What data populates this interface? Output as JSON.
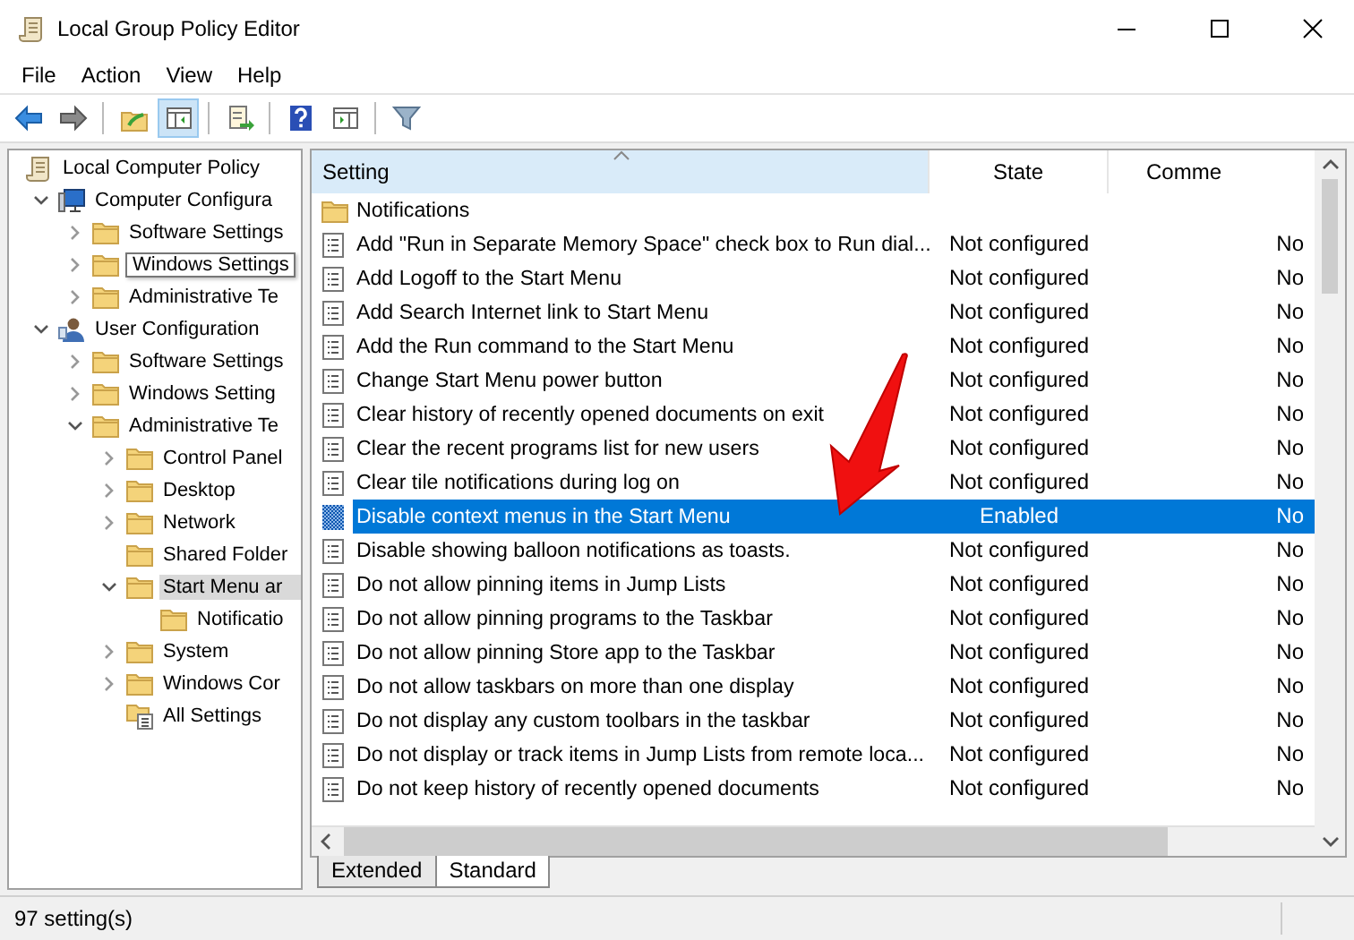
{
  "window": {
    "title": "Local Group Policy Editor"
  },
  "menu": [
    "File",
    "Action",
    "View",
    "Help"
  ],
  "toolbar": [
    {
      "kind": "back",
      "pressed": false
    },
    {
      "kind": "forward",
      "pressed": false
    },
    {
      "kind": "separator"
    },
    {
      "kind": "up",
      "pressed": false
    },
    {
      "kind": "tree-toggle",
      "pressed": true
    },
    {
      "kind": "separator"
    },
    {
      "kind": "export",
      "pressed": false
    },
    {
      "kind": "separator"
    },
    {
      "kind": "help",
      "pressed": false
    },
    {
      "kind": "action-pane",
      "pressed": false
    },
    {
      "kind": "separator"
    },
    {
      "kind": "filter",
      "pressed": false
    }
  ],
  "tree": [
    {
      "label": "Local Computer Policy",
      "kind": "policy",
      "selected": false,
      "hovered": false,
      "children": [
        {
          "label": "Computer Configura",
          "kind": "computer",
          "expanded": true,
          "selected": false,
          "hovered": false,
          "children": [
            {
              "label": "Software Settings",
              "kind": "folder",
              "expanded": false,
              "selected": false,
              "hovered": false
            },
            {
              "label": "Windows Settings",
              "kind": "folder",
              "expanded": false,
              "selected": false,
              "hovered": true
            },
            {
              "label": "Administrative Te",
              "kind": "folder",
              "expanded": false,
              "selected": false,
              "hovered": false
            }
          ]
        },
        {
          "label": "User Configuration",
          "kind": "user",
          "expanded": true,
          "selected": false,
          "hovered": false,
          "children": [
            {
              "label": "Software Settings",
              "kind": "folder",
              "expanded": false,
              "selected": false,
              "hovered": false
            },
            {
              "label": "Windows Setting",
              "kind": "folder",
              "expanded": false,
              "selected": false,
              "hovered": false
            },
            {
              "label": "Administrative Te",
              "kind": "folder",
              "expanded": true,
              "selected": false,
              "hovered": false,
              "children": [
                {
                  "label": "Control Panel",
                  "kind": "folder",
                  "expanded": false,
                  "selected": false,
                  "hovered": false
                },
                {
                  "label": "Desktop",
                  "kind": "folder",
                  "expanded": false,
                  "selected": false,
                  "hovered": false
                },
                {
                  "label": "Network",
                  "kind": "folder",
                  "expanded": false,
                  "selected": false,
                  "hovered": false
                },
                {
                  "label": "Shared Folder",
                  "kind": "folder",
                  "selected": false,
                  "hovered": false
                },
                {
                  "label": "Start Menu ar",
                  "kind": "folder",
                  "expanded": true,
                  "selected": true,
                  "hovered": false,
                  "children": [
                    {
                      "label": "Notificatio",
                      "kind": "folder",
                      "selected": false,
                      "hovered": false
                    }
                  ]
                },
                {
                  "label": "System",
                  "kind": "folder",
                  "expanded": false,
                  "selected": false,
                  "hovered": false
                },
                {
                  "label": "Windows Cor",
                  "kind": "folder",
                  "expanded": false,
                  "selected": false,
                  "hovered": false
                },
                {
                  "label": "All Settings",
                  "kind": "all-settings",
                  "selected": false,
                  "hovered": false
                }
              ]
            }
          ]
        }
      ]
    }
  ],
  "list": {
    "columns": [
      {
        "label": "Setting",
        "sorted": true
      },
      {
        "label": "State",
        "sorted": false
      },
      {
        "label": "Comme",
        "sorted": false
      }
    ],
    "rows": [
      {
        "kind": "folder",
        "setting": "Notifications",
        "selected": false
      },
      {
        "kind": "policy",
        "setting": "Add \"Run in Separate Memory Space\" check box to Run dial...",
        "state": "Not configured",
        "comment": "No",
        "selected": false
      },
      {
        "kind": "policy",
        "setting": "Add Logoff to the Start Menu",
        "state": "Not configured",
        "comment": "No",
        "selected": false
      },
      {
        "kind": "policy",
        "setting": "Add Search Internet link to Start Menu",
        "state": "Not configured",
        "comment": "No",
        "selected": false
      },
      {
        "kind": "policy",
        "setting": "Add the Run command to the Start Menu",
        "state": "Not configured",
        "comment": "No",
        "selected": false
      },
      {
        "kind": "policy",
        "setting": "Change Start Menu power button",
        "state": "Not configured",
        "comment": "No",
        "selected": false
      },
      {
        "kind": "policy",
        "setting": "Clear history of recently opened documents on exit",
        "state": "Not configured",
        "comment": "No",
        "selected": false
      },
      {
        "kind": "policy",
        "setting": "Clear the recent programs list for new users",
        "state": "Not configured",
        "comment": "No",
        "selected": false
      },
      {
        "kind": "policy",
        "setting": "Clear tile notifications during log on",
        "state": "Not configured",
        "comment": "No",
        "selected": false
      },
      {
        "kind": "policy",
        "setting": "Disable context menus in the Start Menu",
        "state": "Enabled",
        "comment": "No",
        "selected": true
      },
      {
        "kind": "policy",
        "setting": "Disable showing balloon notifications as toasts.",
        "state": "Not configured",
        "comment": "No",
        "selected": false
      },
      {
        "kind": "policy",
        "setting": "Do not allow pinning items in Jump Lists",
        "state": "Not configured",
        "comment": "No",
        "selected": false
      },
      {
        "kind": "policy",
        "setting": "Do not allow pinning programs to the Taskbar",
        "state": "Not configured",
        "comment": "No",
        "selected": false
      },
      {
        "kind": "policy",
        "setting": "Do not allow pinning Store app to the Taskbar",
        "state": "Not configured",
        "comment": "No",
        "selected": false
      },
      {
        "kind": "policy",
        "setting": "Do not allow taskbars on more than one display",
        "state": "Not configured",
        "comment": "No",
        "selected": false
      },
      {
        "kind": "policy",
        "setting": "Do not display any custom toolbars in the taskbar",
        "state": "Not configured",
        "comment": "No",
        "selected": false
      },
      {
        "kind": "policy",
        "setting": "Do not display or track items in Jump Lists from remote loca...",
        "state": "Not configured",
        "comment": "No",
        "selected": false
      },
      {
        "kind": "policy",
        "setting": "Do not keep history of recently opened documents",
        "state": "Not configured",
        "comment": "No",
        "selected": false
      }
    ]
  },
  "tabs": [
    {
      "label": "Extended",
      "selected": false
    },
    {
      "label": "Standard",
      "selected": true
    }
  ],
  "status_bar": {
    "text": "97 setting(s)"
  }
}
